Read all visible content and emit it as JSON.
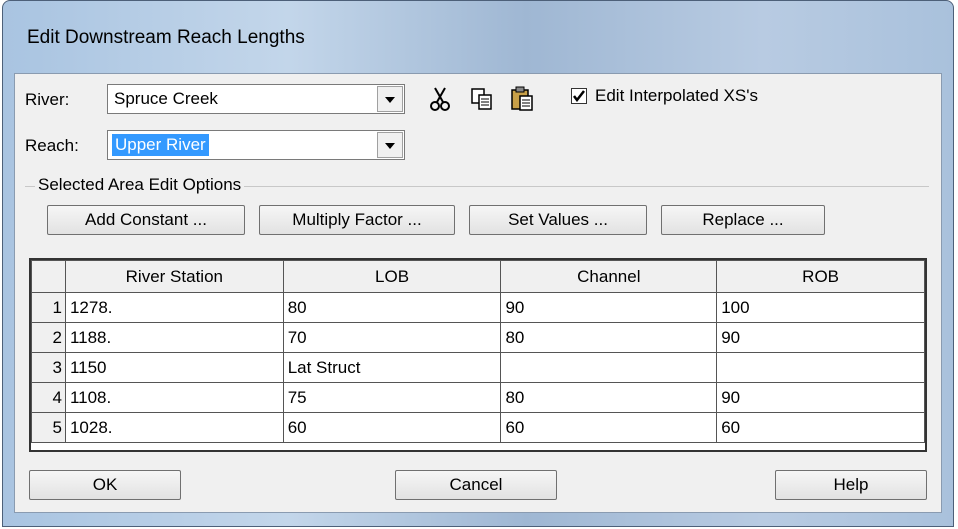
{
  "window": {
    "title": "Edit Downstream Reach Lengths"
  },
  "river": {
    "label": "River:",
    "value": "Spruce Creek"
  },
  "reach": {
    "label": "Reach:",
    "value": "Upper River"
  },
  "toolbar": {
    "cut_icon": "scissors-icon",
    "copy_icon": "copy-icon",
    "paste_icon": "paste-icon"
  },
  "edit_interpolated": {
    "label": "Edit Interpolated XS's",
    "checked": true
  },
  "edit_options": {
    "group_label": "Selected Area Edit Options",
    "add_constant": "Add Constant ...",
    "multiply_factor": "Multiply Factor ...",
    "set_values": "Set Values ...",
    "replace": "Replace ..."
  },
  "table": {
    "headers": [
      "River Station",
      "LOB",
      "Channel",
      "ROB"
    ],
    "rows": [
      {
        "num": "1",
        "station": "1278.",
        "lob": "80",
        "channel": "90",
        "rob": "100"
      },
      {
        "num": "2",
        "station": "1188.",
        "lob": "70",
        "channel": "80",
        "rob": "90"
      },
      {
        "num": "3",
        "station": "1150",
        "lob": "Lat Struct",
        "channel": "",
        "rob": ""
      },
      {
        "num": "4",
        "station": "1108.",
        "lob": "75",
        "channel": "80",
        "rob": "90"
      },
      {
        "num": "5",
        "station": "1028.",
        "lob": "60",
        "channel": "60",
        "rob": "60"
      }
    ]
  },
  "footer": {
    "ok": "OK",
    "cancel": "Cancel",
    "help": "Help"
  }
}
